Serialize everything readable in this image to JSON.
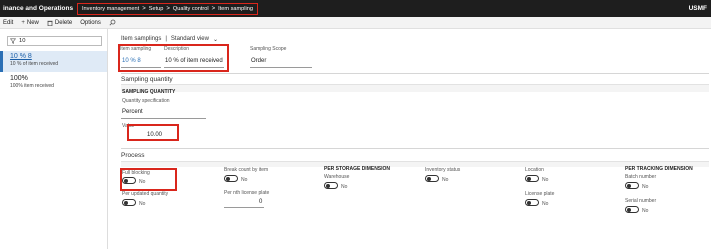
{
  "topbar": {
    "app_title": "inance and Operations",
    "breadcrumbs": [
      "Inventory management",
      "Setup",
      "Quality control",
      "Item sampling"
    ],
    "company": "USMF"
  },
  "actions": {
    "edit": "Edit",
    "new": "New",
    "delete": "Delete",
    "options": "Options"
  },
  "list": {
    "filter_value": "10",
    "items": [
      {
        "id": "10 % 8",
        "desc": "10 % of item received"
      },
      {
        "id": "100%",
        "desc": "100% item received"
      }
    ]
  },
  "form": {
    "title": "Item samplings",
    "view": "Standard view",
    "item_sampling_label": "Item sampling",
    "item_sampling_value": "10 % 8",
    "description_label": "Description",
    "description_value": "10 % of item received",
    "scope_label": "Sampling Scope",
    "scope_value": "Order"
  },
  "sampling_quantity": {
    "section_title": "Sampling quantity",
    "group_title": "SAMPLING QUANTITY",
    "spec_label": "Quantity specification",
    "spec_value": "Percent",
    "value_label": "Value",
    "value_value": "10.00"
  },
  "process": {
    "section_title": "Process",
    "full_blocking_label": "Full blocking",
    "full_blocking_value": "No",
    "per_updated_label": "Per updated quantity",
    "per_updated_value": "No",
    "break_label": "Break count by item",
    "break_value": "No",
    "per_nth_label": "Per nth license plate",
    "per_nth_value": "0",
    "storage_title": "PER STORAGE DIMENSION",
    "warehouse_label": "Warehouse",
    "warehouse_value": "No",
    "inv_status_label": "Inventory status",
    "inv_status_value": "No",
    "location_label": "Location",
    "location_value": "No",
    "license_label": "License plate",
    "license_value": "No",
    "tracking_title": "PER TRACKING DIMENSION",
    "batch_label": "Batch number",
    "batch_value": "No",
    "serial_label": "Serial number",
    "serial_value": "No"
  },
  "colors": {
    "highlight": "#d9261c",
    "accent": "#2a6fb5",
    "topbar": "#1e1e1e"
  }
}
